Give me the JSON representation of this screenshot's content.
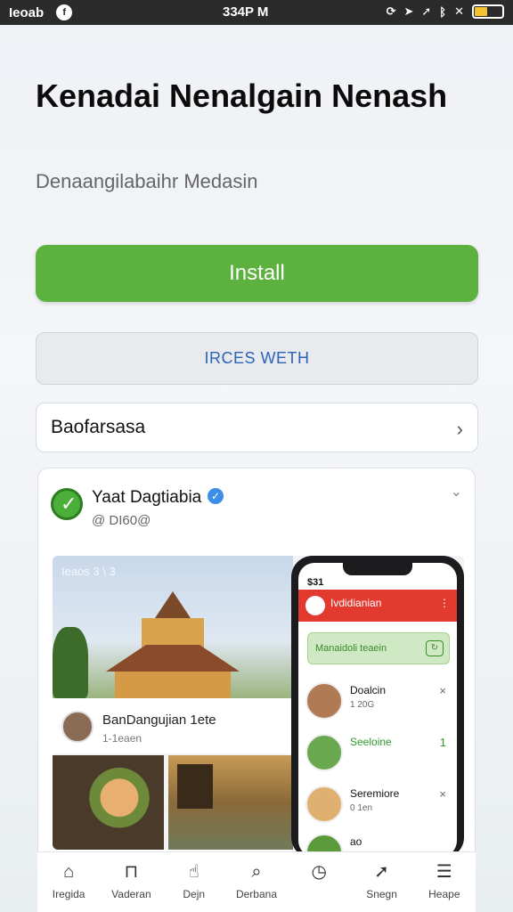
{
  "status_bar": {
    "carrier": "Ieoab",
    "notification": "f",
    "time": "334P M",
    "icons": [
      "circle-arrow-icon",
      "location-icon",
      "navigation-icon",
      "bluetooth-icon",
      "signal-icon",
      "battery-icon"
    ],
    "battery_level": 0.45
  },
  "header": {
    "title": "Kenadai  Nenalgain Nenash",
    "subtitle": "Denaangilabaihr Medasin"
  },
  "buttons": {
    "install_label": "Install",
    "secondary_label": "IRCES WETH",
    "row_label": "Baofarsasa"
  },
  "card": {
    "name": "Yaat Dagtiabia",
    "handle": "@ DI60@",
    "media_text": "Ieaos 3 \\ 3",
    "post": {
      "title": "BanDangujian  1ete",
      "sub": "1-1eaen"
    }
  },
  "phone": {
    "status": "$31",
    "header_title": "Ivdidianian",
    "search_placeholder": "Manaidoli teaein",
    "items": [
      {
        "name": "Doalcin",
        "sub": "1 20G",
        "action": "×"
      },
      {
        "name": "Seeloine",
        "sub": "",
        "action": "1"
      },
      {
        "name": "Seremiore",
        "sub": "0 1en",
        "action": "×"
      },
      {
        "name": "ao",
        "sub": "",
        "action": ""
      }
    ]
  },
  "colors": {
    "accent_green": "#5db23f",
    "link_blue": "#2a64b8",
    "header_red": "#e23a2e"
  },
  "bottom_nav": [
    {
      "label": "Iregida",
      "icon": "home-icon"
    },
    {
      "label": "Vaderan",
      "icon": "bag-icon"
    },
    {
      "label": "Dejn",
      "icon": "hand-icon"
    },
    {
      "label": "Derbana",
      "icon": "search-icon"
    },
    {
      "label": "",
      "icon": "clock-icon"
    },
    {
      "label": "Snegn",
      "icon": "share-icon"
    },
    {
      "label": "Heape",
      "icon": "menu-icon"
    }
  ]
}
